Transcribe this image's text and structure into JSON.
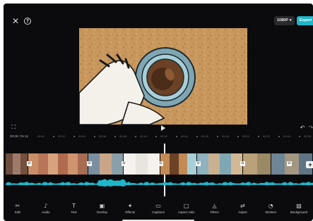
{
  "header": {
    "close_icon": "close-icon",
    "help_icon": "help-icon",
    "resolution": "1080P",
    "export_label": "Export",
    "accent_color": "#1fb6c9"
  },
  "preview": {
    "content": "illustrated coffee cup viewed from above with a hand"
  },
  "playback": {
    "current_time": "00:28",
    "total_time": "01:11",
    "tick_labels": [
      "00:00",
      "00:02",
      "00:04",
      "00:06",
      "00:08",
      "00:10",
      "00:12",
      "00:14",
      "00:16",
      "00:18",
      "00:20",
      "00:22",
      "00:24",
      "00:26"
    ]
  },
  "toolbar": {
    "items": [
      {
        "label": "Edit",
        "icon": "scissors-icon"
      },
      {
        "label": "Audio",
        "icon": "music-note-icon"
      },
      {
        "label": "Text",
        "icon": "text-icon"
      },
      {
        "label": "Overlay",
        "icon": "overlay-icon"
      },
      {
        "label": "Effects",
        "icon": "effects-icon"
      },
      {
        "label": "Captions",
        "icon": "captions-icon"
      },
      {
        "label": "Aspect ratio",
        "icon": "aspect-ratio-icon"
      },
      {
        "label": "Filters",
        "icon": "filters-icon"
      },
      {
        "label": "Adjust",
        "icon": "adjust-icon"
      },
      {
        "label": "Stickers",
        "icon": "stickers-icon"
      },
      {
        "label": "Background",
        "icon": "background-icon"
      }
    ]
  }
}
